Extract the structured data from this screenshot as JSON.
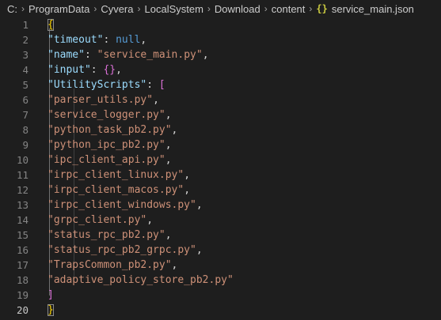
{
  "breadcrumb": {
    "items": [
      "C:",
      "ProgramData",
      "Cyvera",
      "LocalSystem",
      "Download",
      "content"
    ],
    "file_icon": "{}",
    "file_name": "service_main.json"
  },
  "editor": {
    "line_numbers": [
      "1",
      "2",
      "3",
      "4",
      "5",
      "6",
      "7",
      "8",
      "9",
      "10",
      "11",
      "12",
      "13",
      "14",
      "15",
      "16",
      "17",
      "18",
      "19",
      "20"
    ],
    "active_line": "20",
    "open_brace": "{",
    "close_brace": "}",
    "timeout_key": "\"timeout\"",
    "timeout_value": "null",
    "name_key": "\"name\"",
    "name_value": "\"service_main.py\"",
    "input_key": "\"input\"",
    "input_value": "{}",
    "scripts_key": "\"UtilityScripts\"",
    "scripts_open": "[",
    "scripts_close": "]",
    "scripts": [
      "\"parser_utils.py\"",
      "\"service_logger.py\"",
      "\"python_task_pb2.py\"",
      "\"python_ipc_pb2.py\"",
      "\"ipc_client_api.py\"",
      "\"irpc_client_linux.py\"",
      "\"irpc_client_macos.py\"",
      "\"irpc_client_windows.py\"",
      "\"grpc_client.py\"",
      "\"status_rpc_pb2.py\"",
      "\"status_rpc_pb2_grpc.py\"",
      "\"TrapsCommon_pb2.py\"",
      "\"adaptive_policy_store_pb2.py\""
    ]
  }
}
